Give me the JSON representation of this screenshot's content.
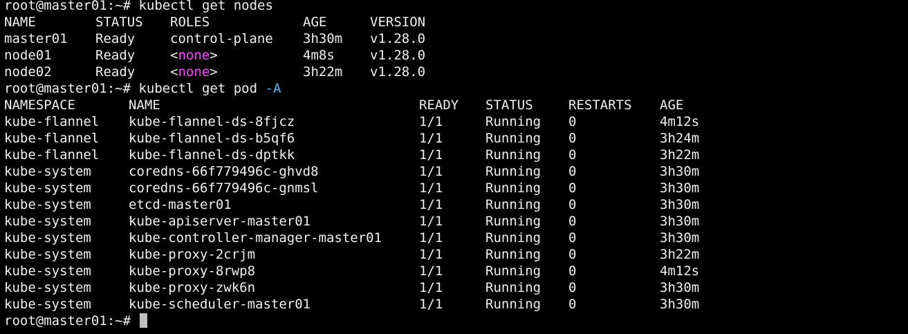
{
  "prompt": "root@master01:~# ",
  "cmd1": "kubectl get nodes",
  "nodes": {
    "headers": [
      "NAME",
      "STATUS",
      "ROLES",
      "AGE",
      "VERSION"
    ],
    "rows": [
      {
        "name": "master01",
        "status": "Ready",
        "role_plain": "control-plane",
        "role_pre": "",
        "role_hl": "",
        "role_post": "",
        "age": "3h30m",
        "version": "v1.28.0"
      },
      {
        "name": "node01",
        "status": "Ready",
        "role_plain": "",
        "role_pre": "<",
        "role_hl": "none",
        "role_post": ">",
        "age": "4m8s",
        "version": "v1.28.0"
      },
      {
        "name": "node02",
        "status": "Ready",
        "role_plain": "",
        "role_pre": "<",
        "role_hl": "none",
        "role_post": ">",
        "age": "3h22m",
        "version": "v1.28.0"
      }
    ]
  },
  "cmd2": "kubectl get pod ",
  "cmd2_flag": "-A",
  "pods": {
    "headers": [
      "NAMESPACE",
      "NAME",
      "READY",
      "STATUS",
      "RESTARTS",
      "AGE"
    ],
    "rows": [
      {
        "ns": "kube-flannel",
        "name": "kube-flannel-ds-8fjcz",
        "ready": "1/1",
        "status": "Running",
        "restarts": "0",
        "age": "4m12s"
      },
      {
        "ns": "kube-flannel",
        "name": "kube-flannel-ds-b5qf6",
        "ready": "1/1",
        "status": "Running",
        "restarts": "0",
        "age": "3h24m"
      },
      {
        "ns": "kube-flannel",
        "name": "kube-flannel-ds-dptkk",
        "ready": "1/1",
        "status": "Running",
        "restarts": "0",
        "age": "3h22m"
      },
      {
        "ns": "kube-system",
        "name": "coredns-66f779496c-ghvd8",
        "ready": "1/1",
        "status": "Running",
        "restarts": "0",
        "age": "3h30m"
      },
      {
        "ns": "kube-system",
        "name": "coredns-66f779496c-gnmsl",
        "ready": "1/1",
        "status": "Running",
        "restarts": "0",
        "age": "3h30m"
      },
      {
        "ns": "kube-system",
        "name": "etcd-master01",
        "ready": "1/1",
        "status": "Running",
        "restarts": "0",
        "age": "3h30m"
      },
      {
        "ns": "kube-system",
        "name": "kube-apiserver-master01",
        "ready": "1/1",
        "status": "Running",
        "restarts": "0",
        "age": "3h30m"
      },
      {
        "ns": "kube-system",
        "name": "kube-controller-manager-master01",
        "ready": "1/1",
        "status": "Running",
        "restarts": "0",
        "age": "3h30m"
      },
      {
        "ns": "kube-system",
        "name": "kube-proxy-2crjm",
        "ready": "1/1",
        "status": "Running",
        "restarts": "0",
        "age": "3h22m"
      },
      {
        "ns": "kube-system",
        "name": "kube-proxy-8rwp8",
        "ready": "1/1",
        "status": "Running",
        "restarts": "0",
        "age": "4m12s"
      },
      {
        "ns": "kube-system",
        "name": "kube-proxy-zwk6n",
        "ready": "1/1",
        "status": "Running",
        "restarts": "0",
        "age": "3h30m"
      },
      {
        "ns": "kube-system",
        "name": "kube-scheduler-master01",
        "ready": "1/1",
        "status": "Running",
        "restarts": "0",
        "age": "3h30m"
      }
    ]
  },
  "colors": {
    "background": "#000000",
    "foreground": "#f0f0f0",
    "none_highlight": "#ff3cff",
    "flag_highlight": "#3fb8f0"
  }
}
